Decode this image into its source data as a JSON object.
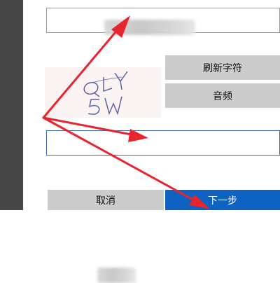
{
  "buttons": {
    "refresh_label": "刷新字符",
    "audio_label": "音频",
    "cancel_label": "取消",
    "next_label": "下一步"
  },
  "colors": {
    "primary_button": "#0d62c2",
    "secondary_button": "#cccccc",
    "annotation_arrow": "#e8242e"
  },
  "captcha": {
    "characters": "QLY5W"
  }
}
